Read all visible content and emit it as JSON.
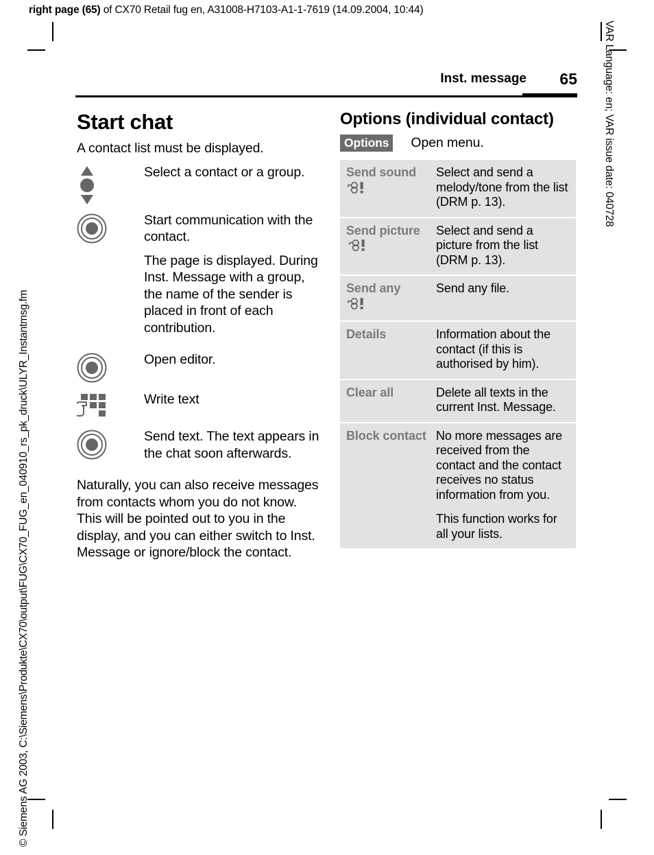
{
  "top_info": {
    "bold": "right page (65)",
    "rest": " of CX70 Retail fug en, A31008-H7103-A1-1-7619 (14.09.2004, 10:44)"
  },
  "side_text": {
    "right": "VAR Language: en; VAR issue date: 040728",
    "left": "© Siemens AG 2003, C:\\Siemens\\Produkte\\CX70\\output\\FUG\\CX70_FUG_en_040910_rs_pk_druck\\ULYR_Instantmsg.fm"
  },
  "header": {
    "title": "Inst. message",
    "page_number": "65"
  },
  "left_column": {
    "title": "Start chat",
    "intro": "A contact list must be displayed.",
    "steps": [
      {
        "icon": "navigation-key-icon",
        "text": "Select a contact or a group."
      },
      {
        "icon": "ok-key-icon",
        "text": "Start communication with the contact."
      },
      {
        "icon": "none",
        "text": "The page is displayed. During Inst. Message with a group, the name of the sender is placed in front of each contribution."
      },
      {
        "icon": "ok-key-icon",
        "text": "Open editor."
      },
      {
        "icon": "keypad-key-icon",
        "text": "Write text"
      },
      {
        "icon": "ok-key-icon",
        "text": "Send text. The text appears in the chat soon afterwards."
      }
    ],
    "closing": "Naturally, you can also receive messages from contacts whom you do not know. This will be pointed out to you in the display, and you can either switch to Inst. Message or ignore/block the contact."
  },
  "right_column": {
    "title": "Options (individual contact)",
    "options_badge": "Options",
    "options_badge_desc": "Open menu.",
    "table": {
      "rows": [
        {
          "term": "Send sound",
          "term_icon": "drm-icon",
          "term_icon_position": "below",
          "desc": [
            "Select and send a melody/tone from the list (DRM p. 13)."
          ]
        },
        {
          "term": "Send picture",
          "term_icon": "drm-icon",
          "term_icon_position": "inline",
          "desc": [
            "Select and send a picture from the list (DRM p. 13)."
          ]
        },
        {
          "term": "Send any",
          "term_icon": "drm-icon",
          "term_icon_position": "below",
          "desc": [
            "Send any file."
          ]
        },
        {
          "term": "Details",
          "term_icon": "none",
          "term_icon_position": "none",
          "desc": [
            "Information about the contact (if this is authorised by him)."
          ]
        },
        {
          "term": "Clear all",
          "term_icon": "none",
          "term_icon_position": "none",
          "desc": [
            "Delete all texts in the current Inst. Message."
          ]
        },
        {
          "term": "Block contact",
          "term_icon": "none",
          "term_icon_position": "none",
          "desc": [
            "No more messages are received from the contact and the contact receives no status information from you.",
            "This  function works for all your lists."
          ]
        }
      ]
    }
  },
  "colors": {
    "table_row_bg": "#e2e2e2",
    "term_text": "#7a7a7a",
    "badge_bg": "#6b6b6b",
    "icon_gray": "#666666"
  }
}
